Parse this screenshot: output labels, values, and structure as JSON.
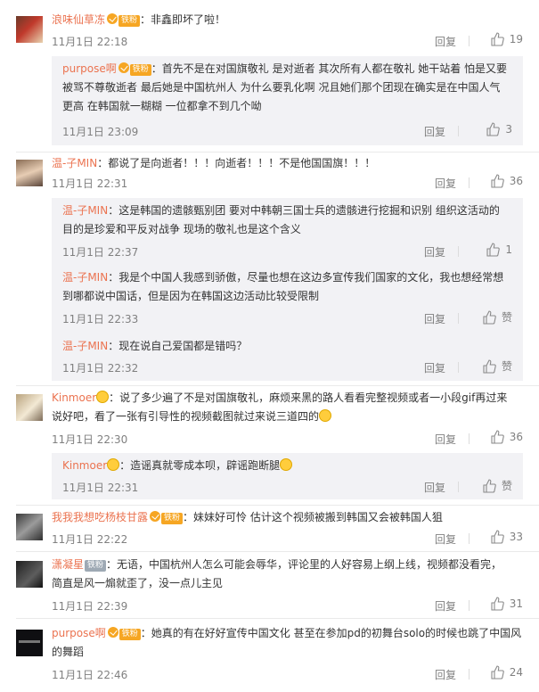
{
  "labels": {
    "reply": "回复",
    "like_word": "赞"
  },
  "comments": [
    {
      "author": "浪味仙草冻",
      "fan_badge": "铁粉",
      "text": "：非鑫即坏了啦！",
      "time": "11月1日 22:18",
      "likes": "19",
      "replies": [
        {
          "author": "purpose啊",
          "fan_badge": "铁粉",
          "lines": [
            "：首先不是在对国旗敬礼 是对逝者 其次所有人都在敬礼 她干站着 怕是又要",
            "被骂不尊敬逝者 最后她是中国杭州人 为什么要乳化啊 况且她们那个团现在确实是在中国人气",
            "更高 在韩国就一糊糊 一位都拿不到几个呦"
          ],
          "time": "11月1日 23:09",
          "likes": "3"
        }
      ]
    },
    {
      "author": "温-子MIN",
      "text": "：都说了是向逝者！！！向逝者！！！不是他国国旗！！！",
      "time": "11月1日 22:31",
      "likes": "36",
      "replies": [
        {
          "author": "温-子MIN",
          "lines": [
            "：这是韩国的遗骸甄别团 要对中韩朝三国士兵的遗骸进行挖掘和识别 组织这活动的",
            "目的是珍爱和平反对战争 现场的敬礼也是这个含义"
          ],
          "time": "11月1日 22:37",
          "likes": "1"
        },
        {
          "author": "温-子MIN",
          "lines": [
            "：我是个中国人我感到骄傲，尽量也想在这边多宣传我们国家的文化，我也想经常想",
            "到哪都说中国话，但是因为在韩国这边活动比较受限制"
          ],
          "time": "11月1日 22:33",
          "likes": "赞"
        },
        {
          "author": "温-子MIN",
          "lines": [
            "：现在说自己爱国都是错吗？"
          ],
          "time": "11月1日 22:32",
          "likes": "赞"
        }
      ]
    },
    {
      "author": "Kinmoer",
      "lines": [
        "：说了多少遍了不是对国旗敬礼，麻烦来黑的路人看看完整视频或者一小段gif再过来",
        "说好吧，看了一张有引导性的视频截图就过来说三道四的"
      ],
      "time": "11月1日 22:30",
      "likes": "36",
      "replies": [
        {
          "author": "Kinmoer",
          "lines": [
            "：造谣真就零成本呗，辟谣跑断腿"
          ],
          "time": "11月1日 22:31",
          "likes": "赞"
        }
      ]
    },
    {
      "author": "我我我想吃杨枝甘露",
      "fan_badge": "铁粉",
      "text": "：妹妹好可怜 估计这个视频被搬到韩国又会被韩国人狙",
      "time": "11月1日 22:22",
      "likes": "33"
    },
    {
      "author": "潇凝星",
      "fan_badge": "铁粉",
      "lines": [
        "：无语，中国杭州人怎么可能会辱华，评论里的人好容易上纲上线，视频都没看完，",
        "简直是风一煽就歪了，没一点儿主见"
      ],
      "time": "11月1日 22:39",
      "likes": "31"
    },
    {
      "author": "purpose啊",
      "fan_badge": "铁粉",
      "lines": [
        "：她真的有在好好宣传中国文化 甚至在参加pd的初舞台solo的时候也跳了中国风",
        "的舞蹈"
      ],
      "time": "11月1日 22:46",
      "likes": "24"
    }
  ]
}
